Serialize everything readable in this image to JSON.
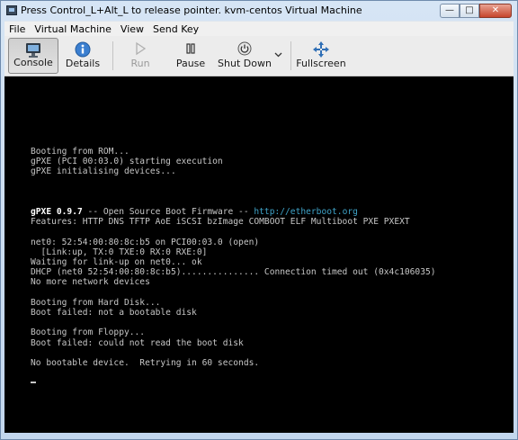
{
  "window": {
    "title": "Press Control_L+Alt_L to release pointer. kvm-centos Virtual Machine",
    "buttons": {
      "minimize": "—",
      "maximize": "□",
      "close": "✕"
    }
  },
  "menubar": {
    "items": [
      "File",
      "Virtual Machine",
      "View",
      "Send Key"
    ]
  },
  "toolbar": {
    "console_label": "Console",
    "details_label": "Details",
    "run_label": "Run",
    "pause_label": "Pause",
    "shutdown_label": "Shut Down",
    "fullscreen_label": "Fullscreen",
    "active_tab": "Console",
    "run_enabled": false
  },
  "console": {
    "lines": [
      {
        "text": "Booting from ROM..."
      },
      {
        "text": "gPXE (PCI 00:03.0) starting execution"
      },
      {
        "text": "gPXE initialising devices..."
      },
      {
        "text": ""
      },
      {
        "text": ""
      },
      {
        "text": ""
      },
      {
        "bold": "gPXE 0.9.7",
        "text": " -- Open Source Boot Firmware -- ",
        "link": "http://etherboot.org"
      },
      {
        "text": "Features: HTTP DNS TFTP AoE iSCSI bzImage COMBOOT ELF Multiboot PXE PXEXT"
      },
      {
        "text": ""
      },
      {
        "text": "net0: 52:54:00:80:8c:b5 on PCI00:03.0 (open)"
      },
      {
        "text": "  [Link:up, TX:0 TXE:0 RX:0 RXE:0]"
      },
      {
        "text": "Waiting for link-up on net0... ok"
      },
      {
        "text": "DHCP (net0 52:54:00:80:8c:b5)............... Connection timed out (0x4c106035)"
      },
      {
        "text": "No more network devices"
      },
      {
        "text": ""
      },
      {
        "text": "Booting from Hard Disk..."
      },
      {
        "text": "Boot failed: not a bootable disk"
      },
      {
        "text": ""
      },
      {
        "text": "Booting from Floppy..."
      },
      {
        "text": "Boot failed: could not read the boot disk"
      },
      {
        "text": ""
      },
      {
        "text": "No bootable device.  Retrying in 60 seconds."
      },
      {
        "text": ""
      }
    ]
  }
}
